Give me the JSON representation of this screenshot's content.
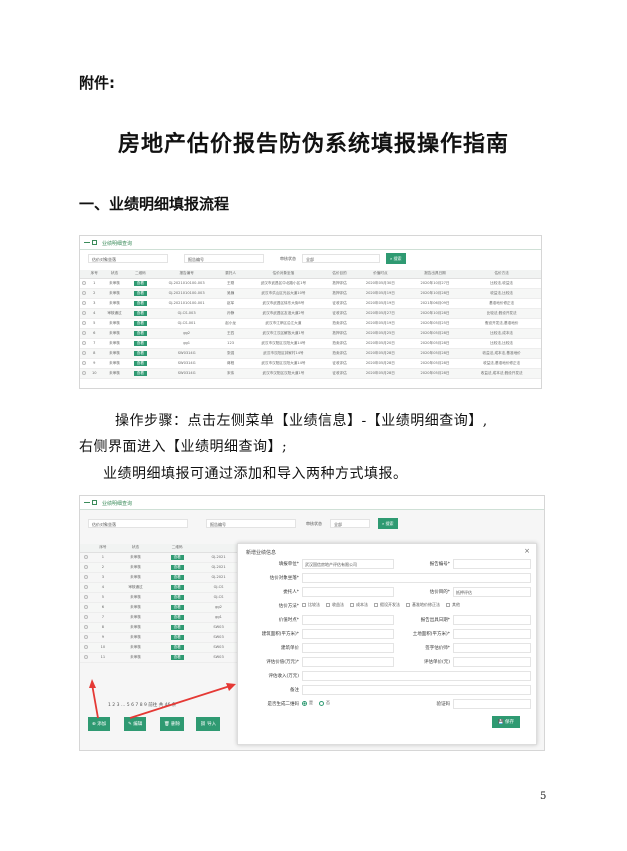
{
  "doc": {
    "appendix": "附件:",
    "title": "房地产估价报告防伪系统填报操作指南",
    "section1": "一、业绩明细填报流程",
    "step_line1": "操作步骤：点击左侧菜单【业绩信息】-【业绩明细查询】,",
    "step_line2": "右侧界面进入【业绩明细查询】;",
    "step_line3": "业绩明细填报可通过添加和导入两种方式填报。",
    "page_number": "5"
  },
  "shot1": {
    "panel_title": "业绩明细查询",
    "filter_project": "估价对象坐落",
    "filter_report": "报告编号",
    "filter_status_label": "审核状态",
    "filter_status_value": "全部",
    "search_button": "搜索",
    "columns": [
      "",
      "序号",
      "状态",
      "二维码",
      "报告编号",
      "委托人",
      "估价对象坐落",
      "估价目的",
      "价值时点",
      "报告出具日期",
      "估价方法"
    ],
    "rows": [
      [
        "1",
        "未审核",
        "查看",
        "GJ-2021010100-003",
        "王刚",
        "武汉市武昌区中北路小区1号",
        "抵押评估",
        "2020年05月30日",
        "2020年10月27日",
        "比较法,收益法"
      ],
      [
        "2",
        "未审核",
        "查看",
        "GJ-2021010100-003",
        "吴巍",
        "武汉市洪山区光谷大道10号",
        "抵押评估",
        "2020年05月19日",
        "2020年10月28日",
        "收益法,比较法"
      ],
      [
        "3",
        "未审核",
        "查看",
        "GJ-2021010100-001",
        "赵军",
        "武汉市武昌区徐东大街8号",
        "征收评估",
        "2020年05月19日",
        "2021年06月09日",
        "基准地价修正法"
      ],
      [
        "4",
        "审核通过",
        "查看",
        "GJ-CS-003",
        "孙静",
        "武汉市武昌区友谊大道2号",
        "征收评估",
        "2020年05月27日",
        "2020年10月28日",
        "比较法,假设开发法"
      ],
      [
        "5",
        "未审核",
        "查看",
        "GJ-CS-001",
        "赵小龙",
        "武汉市江岸区沿江大道",
        "拍卖评估",
        "2020年05月19日",
        "2020年05月25日",
        "假设开发法,基准地价"
      ],
      [
        "6",
        "未审核",
        "查看",
        "gg2",
        "王四",
        "武汉市江汉区解放大道1号",
        "抵押评估",
        "2020年05月25日",
        "2020年05月28日",
        "比较法,成本法"
      ],
      [
        "7",
        "未审核",
        "查看",
        "gg1",
        "123",
        "武汉市汉阳区汉阳大道14号",
        "拍卖评估",
        "2020年05月20日",
        "2020年05月28日",
        "比较法,比较法"
      ],
      [
        "8",
        "未审核",
        "查看",
        "SW0314G",
        "张强",
        "武汉市汉阳区钟家村14号",
        "拍卖评估",
        "2020年05月28日",
        "2020年05月28日",
        "收益法,成本法,基准地价"
      ],
      [
        "9",
        "未审核",
        "查看",
        "SW0314G",
        "蒋程",
        "武汉市汉阳区汉阳大道14号",
        "征收评估",
        "2020年05月28日",
        "2020年05月28日",
        "收益法,基准地价修正法"
      ],
      [
        "10",
        "未审核",
        "查看",
        "SW0314G",
        "宋伟",
        "武汉市汉阳区汉阳大道1号",
        "征收评估",
        "2020年05月28日",
        "2020年05月28日",
        "收益法,成本法,假设开发法"
      ]
    ]
  },
  "shot2": {
    "panel_title": "业绩明细查询",
    "filter_project": "估价对象坐落",
    "filter_report": "报告编号",
    "filter_status_label": "审核状态",
    "filter_status_value": "全部",
    "search_button": "搜索",
    "bg_columns": [
      "序号",
      "状态",
      "二维码"
    ],
    "bg_rows": [
      [
        "1",
        "未审核",
        "查看",
        "GJ-2021"
      ],
      [
        "2",
        "未审核",
        "查看",
        "GJ-2021"
      ],
      [
        "3",
        "未审核",
        "查看",
        "GJ-2021"
      ],
      [
        "4",
        "审核通过",
        "查看",
        "GJ-CS"
      ],
      [
        "5",
        "未审核",
        "查看",
        "GJ-CS"
      ],
      [
        "6",
        "未审核",
        "查看",
        "gg2"
      ],
      [
        "7",
        "未审核",
        "查看",
        "gg1"
      ],
      [
        "8",
        "未审核",
        "查看",
        "SW03"
      ],
      [
        "9",
        "未审核",
        "查看",
        "SW03"
      ],
      [
        "10",
        "未审核",
        "查看",
        "SW03"
      ],
      [
        "11",
        "未审核",
        "查看",
        "SW03"
      ]
    ],
    "pager": "1  2  3  …  5  6  7  8  9  前往  共 46 条",
    "toolbar": {
      "add": "添加",
      "edit": "编辑",
      "delete": "删除",
      "import": "导入"
    },
    "modal": {
      "title": "新增业绩信息",
      "close": "×",
      "rows": [
        {
          "l": "填报单位*",
          "v": "武汉国信房地产评估有限公司",
          "l2": "报告编号*",
          "v2": ""
        },
        {
          "l": "估价对象坐落*",
          "v": "",
          "l2": "",
          "v2": ""
        },
        {
          "l": "委托人*",
          "v": "",
          "l2": "估价目的*",
          "v2": "抵押评估"
        },
        {
          "l": "估价方法*",
          "v": "",
          "l2": "",
          "v2": ""
        },
        {
          "l": "价值时点*",
          "v": "",
          "l2": "报告出具日期*",
          "v2": ""
        },
        {
          "l": "建筑面积(平方米)*",
          "v": "",
          "l2": "土地面积(平方米)*",
          "v2": ""
        },
        {
          "l": "建筑单价",
          "v": "",
          "l2": "签字估价师*",
          "v2": ""
        },
        {
          "l": "评估价值(万元)*",
          "v": "",
          "l2": "评估单价(元)",
          "v2": ""
        },
        {
          "l": "评估收入(万元)",
          "v": "",
          "l2": "",
          "v2": ""
        },
        {
          "l": "备注",
          "v": "",
          "l2": "",
          "v2": ""
        },
        {
          "l": "是否生成二维码",
          "v": "",
          "l2": "验证码",
          "v2": ""
        }
      ],
      "methods": [
        "比较法",
        "收益法",
        "成本法",
        "假设开发法",
        "基准地价修正法",
        "其他"
      ],
      "qr_yes": "是",
      "qr_no": "否",
      "save": "保存"
    }
  },
  "colors": {
    "accent": "#2f9a72",
    "arrow": "#e53935"
  }
}
